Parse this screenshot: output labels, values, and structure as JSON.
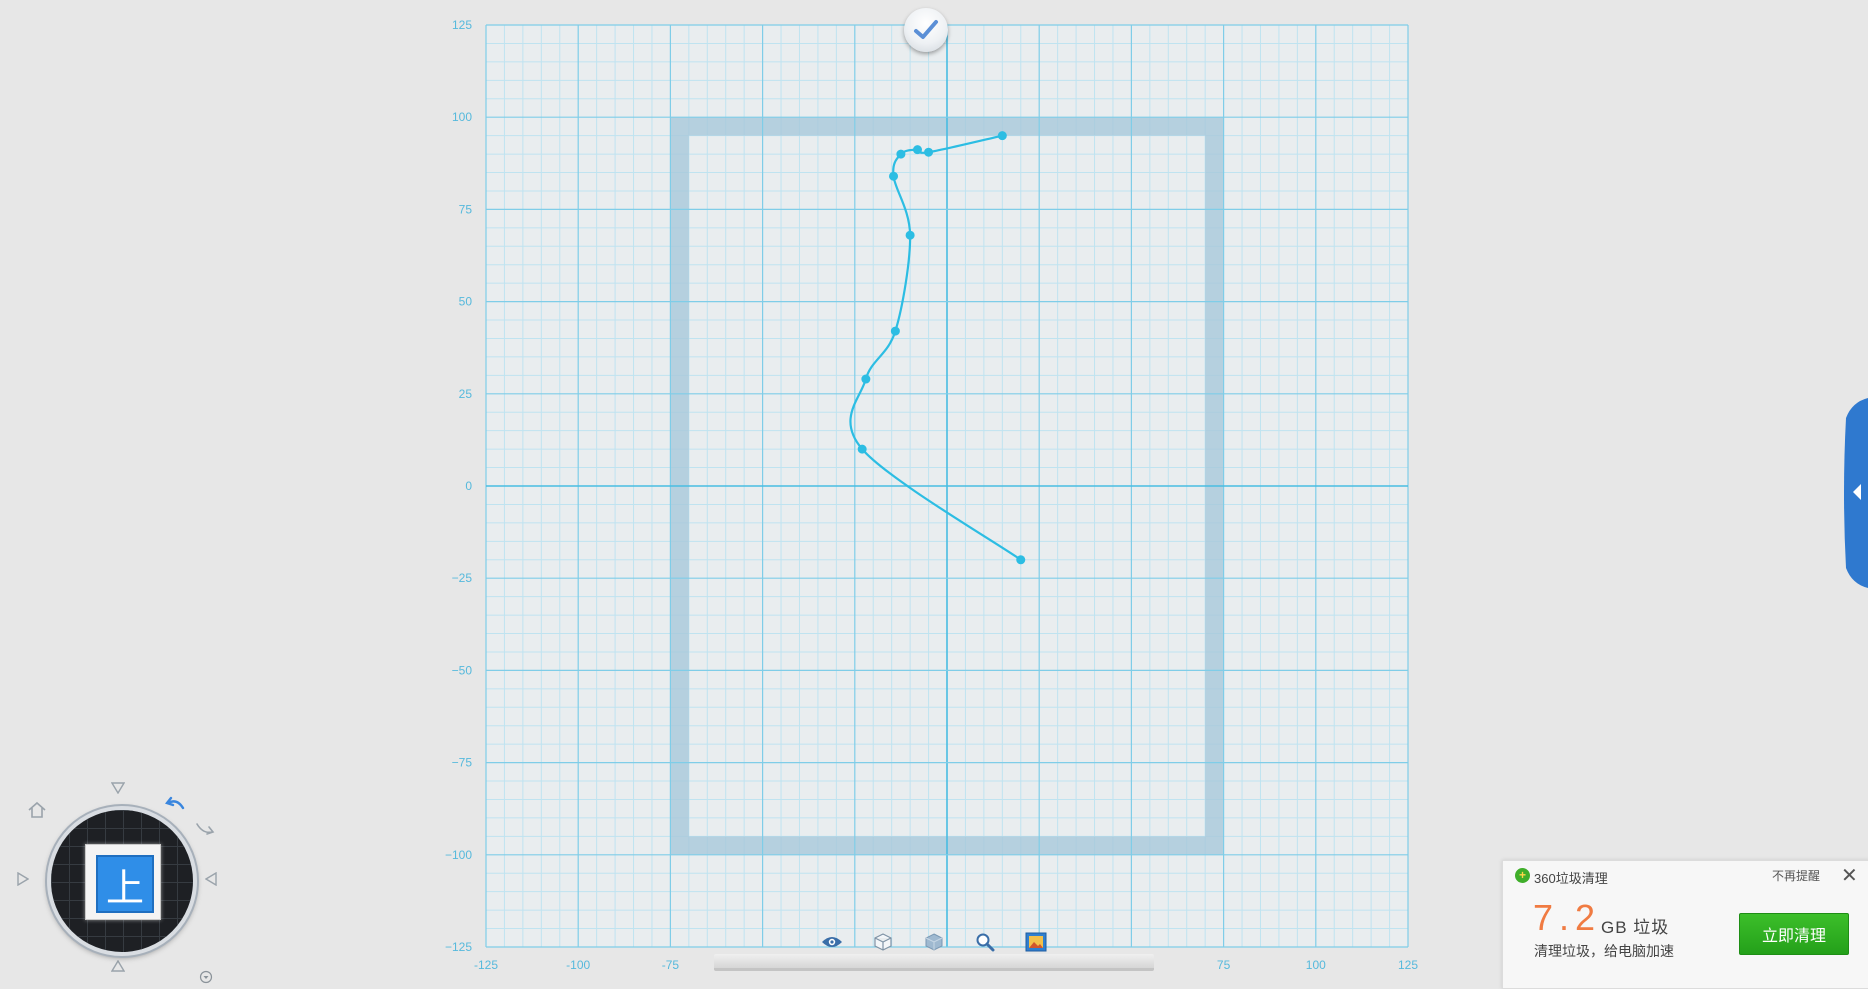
{
  "colors": {
    "background": "#e7e7e7",
    "grid_fine": "#bfe3f0",
    "grid_major": "#7fcde8",
    "axis": "#49bde2",
    "tick_label": "#56b9dc",
    "frame": "#a8c8db",
    "curve": "#2cbde3",
    "accent_blue": "#2f8ee8",
    "notify_number": "#f07b42",
    "notify_button": "#2fb022"
  },
  "canvas": {
    "x_range": [
      -125,
      125
    ],
    "y_range": [
      -125,
      125
    ],
    "minor_step": 5,
    "major_step": 25,
    "x_ticks": [
      "-125",
      "-100",
      "-75",
      "",
      "",
      "",
      "",
      "",
      "75",
      "100",
      "125"
    ],
    "y_ticks": [
      "125",
      "100",
      "75",
      "50",
      "25",
      "0",
      "−25",
      "−50",
      "−75",
      "−100",
      "−125"
    ],
    "frame_outer": {
      "x": [
        -75,
        75
      ],
      "y": [
        -100,
        100
      ]
    },
    "frame_inner": {
      "x": [
        -70,
        70
      ],
      "y": [
        -95,
        95
      ]
    },
    "curve_points": [
      [
        15,
        95
      ],
      [
        -5,
        90.5
      ],
      [
        -8,
        91.2
      ],
      [
        -12.5,
        90
      ],
      [
        -14.5,
        84
      ],
      [
        -10,
        68
      ],
      [
        -14,
        42
      ],
      [
        -22,
        29
      ],
      [
        -23,
        10
      ],
      [
        20,
        -20
      ]
    ]
  },
  "nav_cube": {
    "face_label": "上",
    "icons": [
      "home-icon",
      "rotate-left-icon",
      "rotate-right-icon",
      "arrow-up-icon",
      "arrow-down-icon",
      "arrow-left-icon",
      "arrow-right-icon",
      "dropdown-icon"
    ]
  },
  "toolbar": {
    "icons": [
      "eye-icon",
      "cube-icon",
      "box-icon",
      "zoom-icon",
      "image-icon"
    ]
  },
  "notification": {
    "title": "360垃圾清理",
    "dismiss": "不再提醒",
    "close": "✕",
    "amount": "7.2",
    "unit": "GB 垃圾",
    "subtitle": "清理垃圾，给电脑加速",
    "button": "立即清理"
  }
}
